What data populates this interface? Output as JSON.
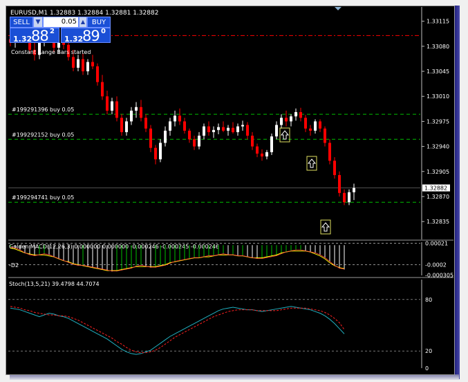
{
  "window": {
    "symbol_line": "EURUSD,M1  1.32883 1.32884 1.32881 1.32882"
  },
  "trade_panel": {
    "sell_label": "SELL",
    "buy_label": "BUY",
    "lot_value": "0.05",
    "sell_price_prefix": "1.32",
    "sell_price_main": "88",
    "sell_price_sup": "2",
    "buy_price_prefix": "1.32",
    "buy_price_main": "89",
    "buy_price_sup": "0"
  },
  "colors": {
    "background": "#000000",
    "bull": "#ffffff",
    "bear": "#ff0000",
    "buy_line": "#00c000",
    "sl_line": "#ff0000",
    "grid": "#c0c0c0",
    "macd_hist_pos": "#00c000",
    "macd_hist_neg": "#ffffff",
    "macd_signal": "#ffff00",
    "stoch_main": "#20b0c0",
    "stoch_signal": "#ff2020"
  },
  "chart_data": [
    {
      "type": "candlestick",
      "title": "EURUSD,M1",
      "annotation": "Constant Range Bars started",
      "ylim": [
        1.3281,
        1.33135
      ],
      "yticks": [
        "1.33115",
        "1.33080",
        "1.33045",
        "1.33010",
        "1.32975",
        "1.32940",
        "1.32905",
        "1.32870",
        "1.32835"
      ],
      "current_price": "1.32882",
      "current_price_value": 1.32882,
      "sl_level": 1.33095,
      "orders": [
        {
          "label": "#199291396 buy 0.05",
          "price": 1.32985
        },
        {
          "label": "#199292152 buy 0.05",
          "price": 1.3295
        },
        {
          "label": "#199294741 buy 0.05",
          "price": 1.32862
        }
      ],
      "candles": [
        [
          1.3309,
          1.33098,
          1.3308,
          1.33085
        ],
        [
          1.33085,
          1.33095,
          1.33078,
          1.33092
        ],
        [
          1.33092,
          1.33105,
          1.33088,
          1.331
        ],
        [
          1.331,
          1.33112,
          1.3309,
          1.33095
        ],
        [
          1.33095,
          1.331,
          1.3307,
          1.33075
        ],
        [
          1.33075,
          1.3309,
          1.3306,
          1.33068
        ],
        [
          1.33068,
          1.3309,
          1.33062,
          1.33085
        ],
        [
          1.33085,
          1.33102,
          1.3308,
          1.33098
        ],
        [
          1.33098,
          1.3311,
          1.33085,
          1.3309
        ],
        [
          1.3309,
          1.331,
          1.33072,
          1.33078
        ],
        [
          1.33078,
          1.33098,
          1.3307,
          1.33093
        ],
        [
          1.33093,
          1.33102,
          1.33076,
          1.33082
        ],
        [
          1.33082,
          1.3309,
          1.3306,
          1.33065
        ],
        [
          1.33065,
          1.33075,
          1.33045,
          1.3305
        ],
        [
          1.3305,
          1.33068,
          1.33045,
          1.33062
        ],
        [
          1.33062,
          1.3307,
          1.3304,
          1.33045
        ],
        [
          1.33045,
          1.33062,
          1.3304,
          1.33058
        ],
        [
          1.33058,
          1.33068,
          1.33048,
          1.33052
        ],
        [
          1.33052,
          1.33056,
          1.33025,
          1.3303
        ],
        [
          1.3303,
          1.3304,
          1.33005,
          1.3301
        ],
        [
          1.3301,
          1.33018,
          1.32985,
          1.3299
        ],
        [
          1.3299,
          1.33008,
          1.32985,
          1.33003
        ],
        [
          1.33003,
          1.3301,
          1.32975,
          1.3298
        ],
        [
          1.3298,
          1.32985,
          1.32955,
          1.3296
        ],
        [
          1.3296,
          1.3298,
          1.32955,
          1.32975
        ],
        [
          1.32975,
          1.32995,
          1.3297,
          1.3299
        ],
        [
          1.3299,
          1.33002,
          1.3298,
          1.32995
        ],
        [
          1.32995,
          1.33005,
          1.32975,
          1.3298
        ],
        [
          1.3298,
          1.32985,
          1.3296,
          1.32965
        ],
        [
          1.32965,
          1.3297,
          1.32932,
          1.32938
        ],
        [
          1.32938,
          1.32942,
          1.32915,
          1.32922
        ],
        [
          1.32922,
          1.3295,
          1.32918,
          1.32945
        ],
        [
          1.32945,
          1.32968,
          1.3294,
          1.32962
        ],
        [
          1.32962,
          1.3298,
          1.32955,
          1.32975
        ],
        [
          1.32975,
          1.3299,
          1.32968,
          1.32983
        ],
        [
          1.32983,
          1.32993,
          1.3297,
          1.32975
        ],
        [
          1.32975,
          1.3298,
          1.32958,
          1.32962
        ],
        [
          1.32962,
          1.32965,
          1.32945,
          1.3295
        ],
        [
          1.3295,
          1.32955,
          1.32935,
          1.3294
        ],
        [
          1.3294,
          1.3296,
          1.32936,
          1.32955
        ],
        [
          1.32955,
          1.32972,
          1.3295,
          1.32968
        ],
        [
          1.32968,
          1.32975,
          1.32955,
          1.3296
        ],
        [
          1.3296,
          1.32968,
          1.32952,
          1.32963
        ],
        [
          1.32963,
          1.32972,
          1.32957,
          1.32967
        ],
        [
          1.32967,
          1.32975,
          1.3296,
          1.32962
        ],
        [
          1.32962,
          1.3297,
          1.32955,
          1.32966
        ],
        [
          1.32966,
          1.32974,
          1.32958,
          1.3296
        ],
        [
          1.3296,
          1.32972,
          1.32955,
          1.32968
        ],
        [
          1.32968,
          1.32976,
          1.32962,
          1.3297
        ],
        [
          1.3297,
          1.32974,
          1.3295,
          1.32955
        ],
        [
          1.32955,
          1.3296,
          1.32935,
          1.3294
        ],
        [
          1.3294,
          1.32944,
          1.32925,
          1.3293
        ],
        [
          1.3293,
          1.32936,
          1.3292,
          1.32926
        ],
        [
          1.32926,
          1.32935,
          1.32922,
          1.32932
        ],
        [
          1.32932,
          1.32958,
          1.32928,
          1.32954
        ],
        [
          1.32954,
          1.32975,
          1.3295,
          1.3297
        ],
        [
          1.3297,
          1.32985,
          1.32965,
          1.3298
        ],
        [
          1.3298,
          1.3299,
          1.32968,
          1.32975
        ],
        [
          1.32975,
          1.32985,
          1.32968,
          1.32982
        ],
        [
          1.32982,
          1.32993,
          1.32976,
          1.32988
        ],
        [
          1.32988,
          1.32994,
          1.32975,
          1.3298
        ],
        [
          1.3298,
          1.32984,
          1.3296,
          1.32965
        ],
        [
          1.32965,
          1.3297,
          1.32955,
          1.32962
        ],
        [
          1.32962,
          1.32978,
          1.32958,
          1.32975
        ],
        [
          1.32975,
          1.32978,
          1.3296,
          1.32965
        ],
        [
          1.32965,
          1.32968,
          1.3294,
          1.32945
        ],
        [
          1.32945,
          1.3295,
          1.32915,
          1.3292
        ],
        [
          1.3292,
          1.32925,
          1.32895,
          1.329
        ],
        [
          1.329,
          1.32905,
          1.3287,
          1.32875
        ],
        [
          1.32875,
          1.3288,
          1.32858,
          1.32862
        ],
        [
          1.32862,
          1.3288,
          1.32858,
          1.32876
        ],
        [
          1.32876,
          1.32888,
          1.32865,
          1.32882
        ]
      ]
    },
    {
      "type": "bar",
      "title": "Golden MACD(12,26,3) 0.000000 0.000000 -0.000246 -0.000245 -0.000246",
      "label": "-D2",
      "yticks": [
        "0.00021",
        "-0.0002",
        "-0.000305"
      ],
      "ylim": [
        -0.00031,
        3e-05
      ],
      "histogram": [
        -2e-05,
        -3e-05,
        -5e-05,
        -8e-05,
        -0.0001,
        -0.00011,
        -0.0001,
        -9e-05,
        -0.0001,
        -0.00012,
        -0.00014,
        -0.00016,
        -0.00018,
        -0.0002,
        -0.00021,
        -0.00021,
        -0.00022,
        -0.00023,
        -0.00024,
        -0.00025,
        -0.00026,
        -0.00027,
        -0.00027,
        -0.00026,
        -0.00025,
        -0.00024,
        -0.00022,
        -0.00021,
        -0.00022,
        -0.00023,
        -0.00023,
        -0.00022,
        -0.00021,
        -0.00019,
        -0.00017,
        -0.00016,
        -0.00015,
        -0.00014,
        -0.00013,
        -0.00013,
        -0.00012,
        -0.00011,
        -0.00011,
        -0.0001,
        -9e-05,
        -0.0001,
        -0.0001,
        -0.00011,
        -0.00011,
        -0.00012,
        -0.00013,
        -0.00014,
        -0.00014,
        -0.00013,
        -0.00012,
        -0.00011,
        -9e-05,
        -7e-05,
        -6e-05,
        -5e-05,
        -5e-05,
        -6e-05,
        -7e-05,
        -8e-05,
        -0.0001,
        -0.00013,
        -0.00017,
        -0.00021,
        -0.00024,
        -0.00025
      ],
      "signal": [
        -3e-05,
        -4e-05,
        -6e-05,
        -8e-05,
        -9e-05,
        -0.0001,
        -0.0001,
        -0.0001,
        -0.00011,
        -0.00012,
        -0.00014,
        -0.00016,
        -0.00017,
        -0.00019,
        -0.0002,
        -0.00021,
        -0.00022,
        -0.00023,
        -0.00024,
        -0.00025,
        -0.00026,
        -0.00026,
        -0.00026,
        -0.00025,
        -0.00024,
        -0.00023,
        -0.00022,
        -0.00022,
        -0.00022,
        -0.00022,
        -0.00022,
        -0.00021,
        -0.0002,
        -0.00018,
        -0.00017,
        -0.00016,
        -0.00015,
        -0.00014,
        -0.00013,
        -0.00013,
        -0.00012,
        -0.00012,
        -0.00011,
        -0.0001,
        -0.0001,
        -0.0001,
        -0.0001,
        -0.00011,
        -0.00011,
        -0.00012,
        -0.00013,
        -0.00013,
        -0.00013,
        -0.00012,
        -0.00011,
        -0.0001,
        -8e-05,
        -7e-05,
        -6e-05,
        -6e-05,
        -6e-05,
        -6e-05,
        -7e-05,
        -9e-05,
        -0.00011,
        -0.00014,
        -0.00018,
        -0.00021,
        -0.00023,
        -0.00024
      ]
    },
    {
      "type": "line",
      "title": "Stoch(13,5,21) 39.4798 44.7074",
      "ylim": [
        0,
        100
      ],
      "yticks": [
        "80",
        "20",
        "0"
      ],
      "levels": [
        80,
        20
      ],
      "main": [
        70,
        69,
        68,
        66,
        64,
        62,
        60,
        62,
        64,
        63,
        61,
        60,
        58,
        55,
        52,
        49,
        46,
        43,
        40,
        37,
        34,
        30,
        26,
        22,
        19,
        17,
        16,
        17,
        19,
        21,
        25,
        29,
        33,
        37,
        40,
        43,
        46,
        49,
        52,
        55,
        58,
        61,
        64,
        67,
        69,
        70,
        71,
        70,
        69,
        68,
        68,
        67,
        66,
        67,
        68,
        69,
        70,
        71,
        72,
        71,
        70,
        69,
        68,
        66,
        64,
        61,
        57,
        52,
        46,
        40
      ],
      "signal": [
        72,
        71,
        70,
        68,
        67,
        65,
        64,
        63,
        62,
        62,
        61,
        61,
        60,
        58,
        56,
        53,
        50,
        47,
        44,
        41,
        38,
        35,
        31,
        28,
        24,
        21,
        19,
        18,
        18,
        19,
        21,
        24,
        28,
        32,
        36,
        39,
        42,
        45,
        48,
        51,
        54,
        57,
        60,
        62,
        64,
        66,
        67,
        68,
        68,
        68,
        68,
        67,
        67,
        67,
        67,
        67,
        68,
        69,
        70,
        70,
        70,
        70,
        69,
        68,
        67,
        65,
        62,
        58,
        53,
        45
      ]
    }
  ]
}
